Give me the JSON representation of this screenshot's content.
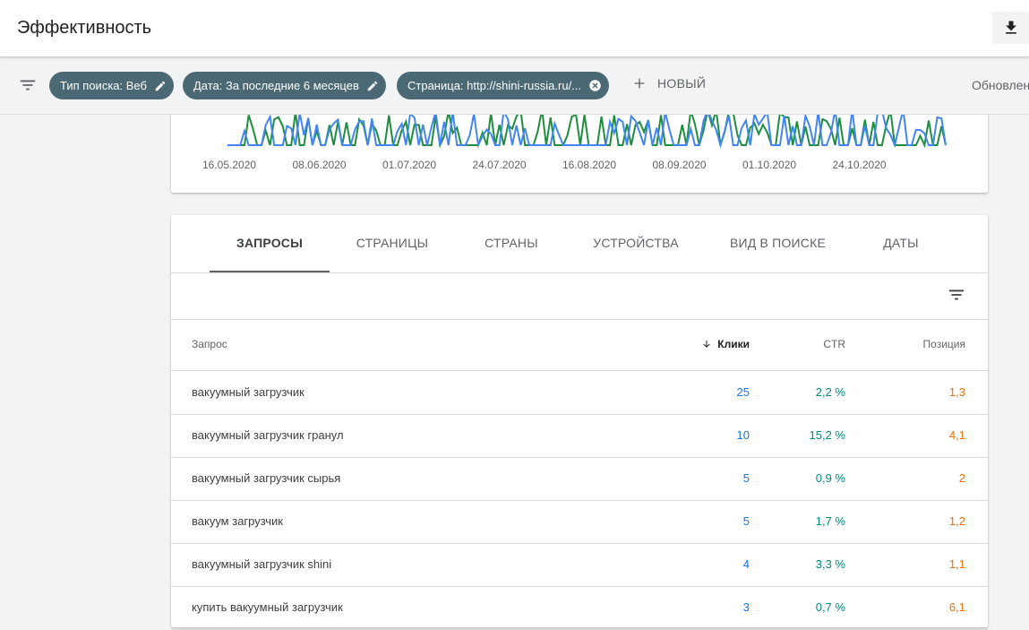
{
  "header": {
    "title": "Эффективность",
    "download_icon": "download-icon"
  },
  "filters": {
    "chips": [
      {
        "label": "Тип поиска: Веб",
        "icon": "edit-icon"
      },
      {
        "label": "Дата: За последние 6 месяцев",
        "icon": "edit-icon"
      },
      {
        "label": "Страница: http://shini-russia.ru/...",
        "icon": "close-circle-icon"
      }
    ],
    "new_label": "НОВЫЙ",
    "updated_text": "Обновлено"
  },
  "chart": {
    "x_ticks": [
      "16.05.2020",
      "08.06.2020",
      "01.07.2020",
      "24.07.2020",
      "16.08.2020",
      "08.09.2020",
      "01.10.2020",
      "24.10.2020"
    ],
    "colors": {
      "clicks": "#4285f4",
      "impressions": "#1e8e3e",
      "position": "#e8710a"
    }
  },
  "tabs": [
    "ЗАПРОСЫ",
    "СТРАНИЦЫ",
    "СТРАНЫ",
    "УСТРОЙСТВА",
    "ВИД В ПОИСКЕ",
    "ДАТЫ"
  ],
  "active_tab": "ЗАПРОСЫ",
  "table": {
    "columns": {
      "query": "Запрос",
      "clicks": "Клики",
      "ctr": "CTR",
      "position": "Позиция"
    },
    "rows": [
      {
        "query": "вакуумный загрузчик",
        "clicks": "25",
        "ctr": "2,2 %",
        "position": "1,3"
      },
      {
        "query": "вакуумный загрузчик гранул",
        "clicks": "10",
        "ctr": "15,2 %",
        "position": "4,1"
      },
      {
        "query": "вакуумный загрузчик сырья",
        "clicks": "5",
        "ctr": "0,9 %",
        "position": "2"
      },
      {
        "query": "вакуум загрузчик",
        "clicks": "5",
        "ctr": "1,7 %",
        "position": "1,2"
      },
      {
        "query": "вакуумный загрузчик shini",
        "clicks": "4",
        "ctr": "3,3 %",
        "position": "1,1"
      },
      {
        "query": "купить вакуумный загрузчик",
        "clicks": "3",
        "ctr": "0,7 %",
        "position": "6,1"
      }
    ]
  }
}
